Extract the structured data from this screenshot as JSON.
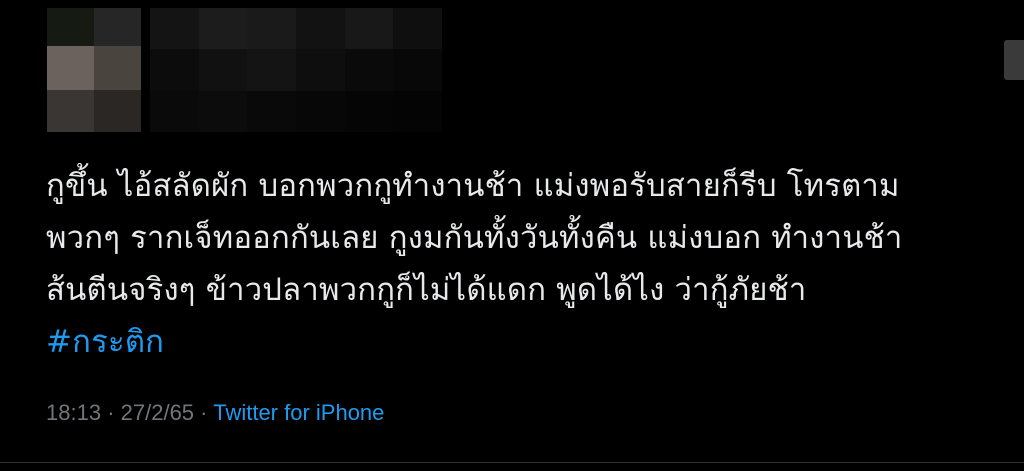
{
  "colors": {
    "background": "#000000",
    "text": "#e7e9ea",
    "link": "#1d9bf0",
    "muted": "#71767b"
  },
  "tweet": {
    "text_lines": [
      "กูขึ้น ไอ้สลัดผัก บอกพวกกูทำงานช้า แม่งพอรับสายก็รีบ โทรตาม",
      "พวกๆ รากเจ็ทออกกันเลย กูงมกันทั้งวันทั้งคืน แม่งบอก ทำงานช้า",
      "ส้นตีนจริงๆ ข้าวปลาพวกกูก็ไม่ได้แดก พูดได้ไง ว่ากู้ภัยช้า"
    ],
    "hashtag": "#กระติก",
    "time": "18:13",
    "separator": "·",
    "date": "27/2/65",
    "source": "Twitter for iPhone"
  }
}
